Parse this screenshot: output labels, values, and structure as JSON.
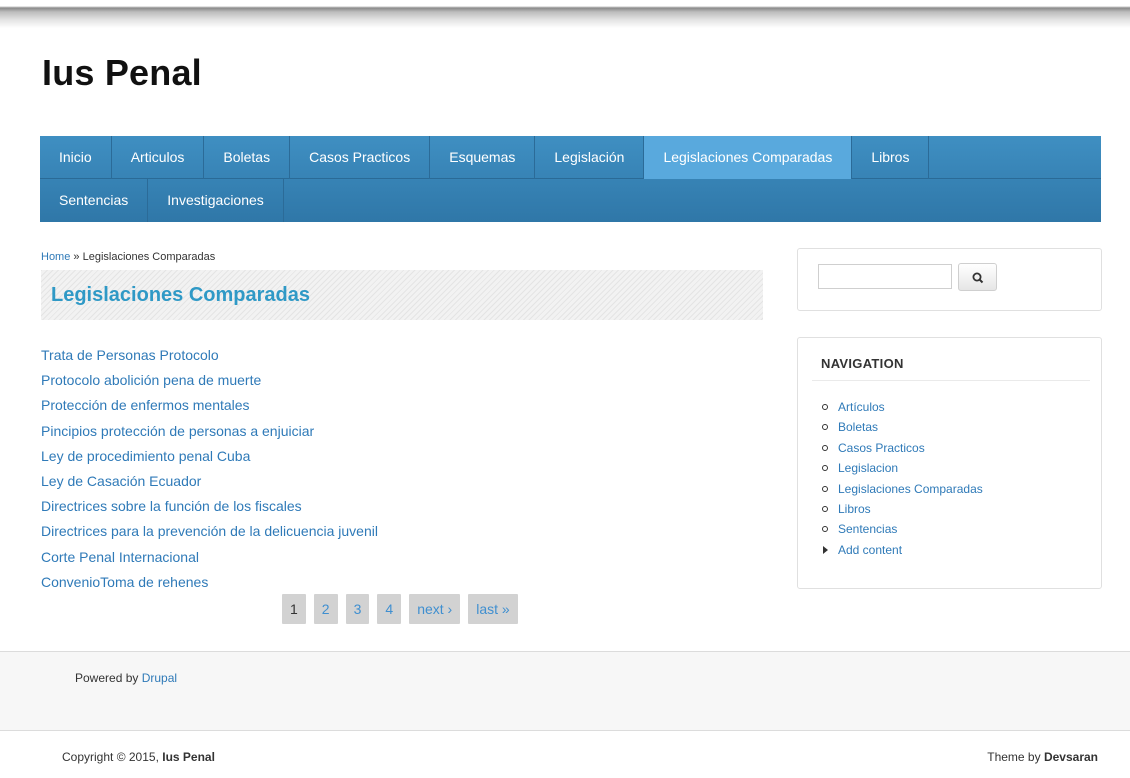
{
  "site": {
    "title": "Ius Penal"
  },
  "nav": {
    "row1": [
      "Inicio",
      "Articulos",
      "Boletas",
      "Casos Practicos",
      "Esquemas",
      "Legislación",
      "Legislaciones Comparadas",
      "Libros"
    ],
    "row2": [
      "Sentencias",
      "Investigaciones"
    ],
    "active": "Legislaciones Comparadas"
  },
  "breadcrumb": {
    "home": "Home",
    "separator": "»",
    "current": "Legislaciones Comparadas"
  },
  "page": {
    "title": "Legislaciones Comparadas"
  },
  "documents": [
    "Trata de Personas Protocolo",
    "Protocolo abolición pena de muerte",
    "Protección de enfermos mentales",
    "Pincipios protección de personas a enjuiciar",
    "Ley de procedimiento penal Cuba",
    "Ley de Casación Ecuador",
    "Directrices sobre la función de los fiscales",
    "Directrices para la prevención de la delicuencia juvenil",
    "Corte Penal Internacional",
    "ConvenioToma de rehenes"
  ],
  "pager": {
    "current": "1",
    "pages": [
      "2",
      "3",
      "4"
    ],
    "next": "next ›",
    "last": "last »"
  },
  "search": {
    "value": "",
    "button_icon": "search-icon"
  },
  "navigation_block": {
    "title": "NAVIGATION",
    "links": [
      "Artículos",
      "Boletas",
      "Casos Practicos",
      "Legislacion",
      "Legislaciones Comparadas",
      "Libros",
      "Sentencias"
    ],
    "add_content": "Add content"
  },
  "footer": {
    "powered_prefix": "Powered by",
    "powered_link": "Drupal",
    "copyright_prefix": "Copyright © 2015,",
    "copyright_name": "Ius Penal",
    "theme_prefix": "Theme by",
    "theme_name": "Devsaran"
  },
  "colors": {
    "nav": "#3583b6",
    "nav_active": "#59a9dd",
    "link": "#2f7ab8",
    "title": "#2f99c6"
  }
}
